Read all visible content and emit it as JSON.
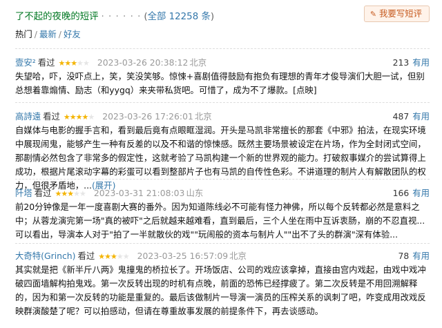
{
  "header": {
    "title": "了不起的夜晚的短评",
    "dots": "· · · · · ·",
    "paren_open": "(",
    "all_link": "全部 12258 条",
    "paren_close": ")",
    "write_button": "我要写短评"
  },
  "tabs": {
    "hot": "热门",
    "sep1": "/",
    "latest": "最新",
    "sep2": "/",
    "friends": "好友"
  },
  "reviews": [
    {
      "user": "壹安²",
      "watched": "看过",
      "stars": 3,
      "time": "2023-03-26 20:38:12",
      "location": "北京",
      "votes": "213",
      "useful": "有用",
      "text": "失望哈，吓，没吓点上，笑，笑没笑够。惊悚+喜剧值得鼓励有抱负有理想的青年才俊导演们大胆一试，但别总想着靠煽情、励志（和yygq）来夹带私货吧。可惜了，成为不了爆款。[点映]",
      "more": ""
    },
    {
      "user": "高詩遠",
      "watched": "看过",
      "stars": 4,
      "time": "2023-03-26 17:26:01",
      "location": "北京",
      "votes": "487",
      "useful": "有用",
      "text": "自媒体与电影的握手言和，看到最后竟有点眼眶湿润。开头是马凯非常擅长的那套《中邪》拍法，在现实环境中展现闹鬼，能够产生一种有反差的以及不和谐的惊悚感。既然主要场景被设定在片场，作为全封闭式空间，那剧情必然包含了非常多的假定性，这就考验了马凯构建一个新的世界观的能力。打破叙事媒介的尝试算得上成功，根据片尾滚动字幕的彩蛋可以看到整部片子也有马凯的自传性色彩。不讲道理的制片人有解散团队的权力，但很矛盾地，...",
      "more": "(展开)"
    },
    {
      "user": "阡塔",
      "watched": "看过",
      "stars": 3,
      "time": "2023-03-31 21:08:03",
      "location": "山东",
      "votes": "166",
      "useful": "有用",
      "text": "前20分钟像是一年一度喜剧大赛的番外。因为知道陈线必不可能有怪力神佛，所以每个反转都必然是意料之中；从蓉龙演完第一场\"真的被吓\"之后就越来越难看，直到最后，三个人坐在雨中互诉衷肠，崩的不忍直视... 可以看出，导演本人对于\"拍了一半就散伙的戏\"\"玩闹般的资本与制片人\"\"出不了头的群演\"深有体验...",
      "more": ""
    },
    {
      "user": "大奇特(Grinch)",
      "watched": "看过",
      "stars": 3,
      "time": "2023-03-25 16:57:09",
      "location": "北京",
      "votes": "78",
      "useful": "有用",
      "text": "其实就是把《新半斤八两》鬼撞鬼的桥拉长了。开场饭店、公司的戏应该拿掉，直接由宫内戏起，由戏中戏冲破四面墙解构拍鬼戏。第一次反转出现的时机有点晚，前面的恐怖已经撑疲了。第二次反转是不用回溯解释的，因为和第一次反转的功能是重复的。最后该做制片一导演一演员的压榨关系的讽刺了吧，咋变成用改戏反映群演酸楚了呢？可以拍感动，但请在尊重故事发展的前提条件下，再去谈感动。",
      "more": ""
    }
  ]
}
